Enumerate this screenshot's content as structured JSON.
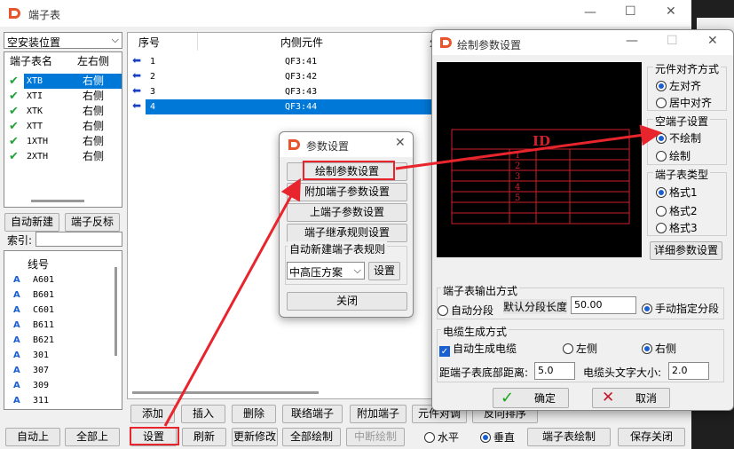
{
  "main_window": {
    "title": "端子表",
    "location_select": "空安装位置",
    "terminal_list_headers": [
      "端子表名",
      "左右侧"
    ],
    "terminal_list": [
      {
        "name": "XTB",
        "side": "右侧",
        "selected": true
      },
      {
        "name": "XTI",
        "side": "右侧"
      },
      {
        "name": "XTK",
        "side": "右侧"
      },
      {
        "name": "XTT",
        "side": "右侧"
      },
      {
        "name": "1XTH",
        "side": "右侧"
      },
      {
        "name": "2XTH",
        "side": "右侧"
      }
    ],
    "auto_new_button": "自动新建",
    "reverse_button": "端子反标",
    "index_label": "索引:",
    "wire_header": "线号",
    "wires": [
      "A601",
      "B601",
      "C601",
      "B611",
      "B621",
      "301",
      "307",
      "309",
      "311"
    ],
    "table_headers": [
      "序号",
      "内侧元件",
      "外"
    ],
    "table_rows": [
      {
        "seq": "1",
        "inner": "QF3:41"
      },
      {
        "seq": "2",
        "inner": "QF3:42"
      },
      {
        "seq": "3",
        "inner": "QF3:43"
      },
      {
        "seq": "4",
        "inner": "QF3:44",
        "selected": true
      }
    ],
    "buttons_row1": [
      "添加",
      "插入",
      "删除",
      "联络端子",
      "附加端子",
      "元件对调",
      "反向排序"
    ],
    "buttons_row2_left": [
      "自动上",
      "全部上"
    ],
    "buttons_row2": [
      "设置",
      "刷新",
      "更新修改",
      "全部绘制",
      "中断绘制"
    ],
    "orient_horizontal": "水平",
    "orient_vertical": "垂直",
    "draw_table_button": "端子表绘制",
    "save_close_button": "保存关闭"
  },
  "param_dialog": {
    "title": "参数设置",
    "buttons": [
      "绘制参数设置",
      "附加端子参数设置",
      "上端子参数设置",
      "端子继承规则设置"
    ],
    "group_label": "自动新建端子表规则",
    "scheme_select": "中高压方案",
    "settings_button": "设置",
    "close_button": "关闭"
  },
  "draw_dialog": {
    "title": "绘制参数设置",
    "preview_id": "ID",
    "preview_numbers": [
      "1",
      "2",
      "3",
      "4",
      "5"
    ],
    "align_group": "元件对齐方式",
    "align_options": [
      "左对齐",
      "居中对齐"
    ],
    "empty_group": "空端子设置",
    "empty_options": [
      "不绘制",
      "绘制"
    ],
    "type_group": "端子表类型",
    "type_options": [
      "格式1",
      "格式2",
      "格式3"
    ],
    "detail_button": "详细参数设置",
    "output_group": "端子表输出方式",
    "auto_segment": "自动分段",
    "default_len_label": "默认分段长度",
    "default_len_value": "50.00",
    "manual_segment": "手动指定分段",
    "cable_group": "电缆生成方式",
    "auto_cable": "自动生成电缆",
    "left_label": "左侧",
    "right_label": "右侧",
    "bottom_dist_label": "距端子表底部距离:",
    "bottom_dist_value": "5.0",
    "cable_text_label": "电缆头文字大小:",
    "cable_text_value": "2.0",
    "ok_button": "确定",
    "cancel_button": "取消"
  },
  "colors": {
    "accent": "#e8242c",
    "selection": "#0078d7",
    "preview_bg": "#000000",
    "preview_lines": "#d0202a"
  }
}
